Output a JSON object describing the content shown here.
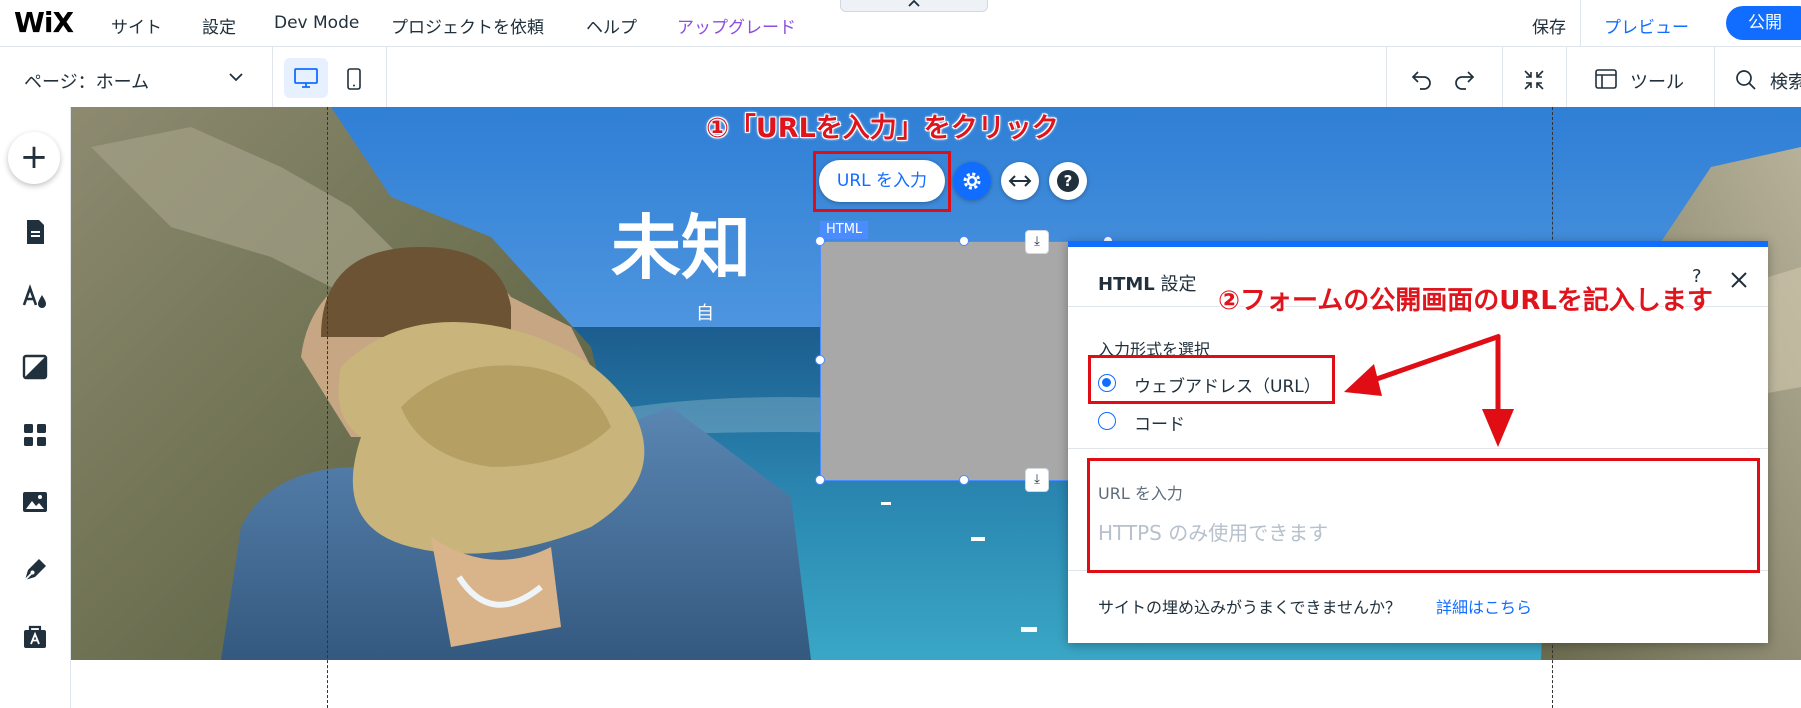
{
  "topbar": {
    "logo": "WiX",
    "menu": [
      "サイト",
      "設定",
      "Dev Mode",
      "プロジェクトを依頼",
      "ヘルプ",
      "アップグレード"
    ],
    "upgrade_color": "#8b4ee0",
    "save": "保存",
    "preview": "プレビュー",
    "publish": "公開",
    "accent": "#116dff"
  },
  "secondbar": {
    "page_selector": "ページ：ホーム",
    "tools": "ツール",
    "search": "検索"
  },
  "lefttoolbar": {
    "items": [
      "add-icon",
      "pages-icon",
      "theme-icon",
      "background-icon",
      "apps-icon",
      "media-icon",
      "blog-pen-icon",
      "business-bag-icon"
    ]
  },
  "canvas": {
    "hero_title": "未知",
    "hero_sub": "自",
    "html_tag": "HTML"
  },
  "element_toolbar": {
    "url_button": "URL を入力"
  },
  "panel": {
    "title_bold": "HTML",
    "title_rest": "設定",
    "help": "?",
    "input_type_label": "入力形式を選択",
    "options": [
      {
        "label": "ウェブアドレス（URL）",
        "selected": true
      },
      {
        "label": "コード",
        "selected": false
      }
    ],
    "url_input_label": "URL を入力",
    "url_input_placeholder": "HTTPS のみ使用できます",
    "help_text": "サイトの埋め込みがうまくできませんか？",
    "help_link": "詳細はこちら"
  },
  "annotations": {
    "step1": "①「URLを入力」をクリック",
    "step2": "②フォームの公開画面のURLを記入します",
    "color": "#e00d14"
  }
}
